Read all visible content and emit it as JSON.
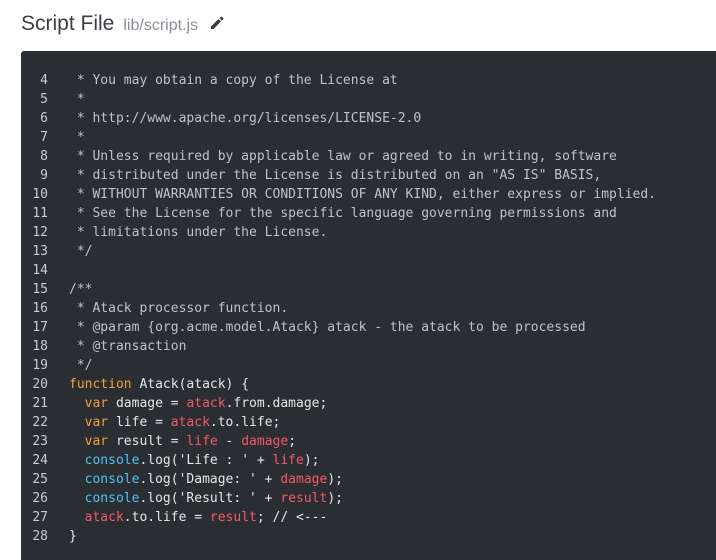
{
  "header": {
    "title": "Script File",
    "path": "lib/script.js",
    "edit_icon": "pencil-icon"
  },
  "editor": {
    "lines": [
      {
        "n": "4",
        "tokens": [
          {
            "c": "com",
            "t": " * You may obtain a copy of the License at"
          }
        ]
      },
      {
        "n": "5",
        "tokens": [
          {
            "c": "com",
            "t": " *"
          }
        ]
      },
      {
        "n": "6",
        "tokens": [
          {
            "c": "com",
            "t": " * http://www.apache.org/licenses/LICENSE-2.0"
          }
        ]
      },
      {
        "n": "7",
        "tokens": [
          {
            "c": "com",
            "t": " *"
          }
        ]
      },
      {
        "n": "8",
        "tokens": [
          {
            "c": "com",
            "t": " * Unless required by applicable law or agreed to in writing, software"
          }
        ]
      },
      {
        "n": "9",
        "tokens": [
          {
            "c": "com",
            "t": " * distributed under the License is distributed on an \"AS IS\" BASIS,"
          }
        ]
      },
      {
        "n": "10",
        "tokens": [
          {
            "c": "com",
            "t": " * WITHOUT WARRANTIES OR CONDITIONS OF ANY KIND, either express or implied."
          }
        ]
      },
      {
        "n": "11",
        "tokens": [
          {
            "c": "com",
            "t": " * See the License for the specific language governing permissions and"
          }
        ]
      },
      {
        "n": "12",
        "tokens": [
          {
            "c": "com",
            "t": " * limitations under the License."
          }
        ]
      },
      {
        "n": "13",
        "tokens": [
          {
            "c": "com",
            "t": " */"
          }
        ]
      },
      {
        "n": "14",
        "tokens": []
      },
      {
        "n": "15",
        "tokens": [
          {
            "c": "com",
            "t": "/**"
          }
        ]
      },
      {
        "n": "16",
        "tokens": [
          {
            "c": "com",
            "t": " * Atack processor function."
          }
        ]
      },
      {
        "n": "17",
        "tokens": [
          {
            "c": "com",
            "t": " * @param {org.acme.model.Atack} atack - the atack to be processed"
          }
        ]
      },
      {
        "n": "18",
        "tokens": [
          {
            "c": "com",
            "t": " * @transaction"
          }
        ]
      },
      {
        "n": "19",
        "tokens": [
          {
            "c": "com",
            "t": " */"
          }
        ]
      },
      {
        "n": "20",
        "tokens": [
          {
            "c": "kw",
            "t": "function"
          },
          {
            "c": "txt",
            "t": " Atack(atack) {"
          }
        ]
      },
      {
        "n": "21",
        "tokens": [
          {
            "c": "txt",
            "t": "  "
          },
          {
            "c": "kw",
            "t": "var"
          },
          {
            "c": "txt",
            "t": " damage = "
          },
          {
            "c": "var",
            "t": "atack"
          },
          {
            "c": "txt",
            "t": ".from.damage;"
          }
        ]
      },
      {
        "n": "22",
        "tokens": [
          {
            "c": "txt",
            "t": "  "
          },
          {
            "c": "kw",
            "t": "var"
          },
          {
            "c": "txt",
            "t": " life = "
          },
          {
            "c": "var",
            "t": "atack"
          },
          {
            "c": "txt",
            "t": ".to.life;"
          }
        ]
      },
      {
        "n": "23",
        "tokens": [
          {
            "c": "txt",
            "t": "  "
          },
          {
            "c": "kw",
            "t": "var"
          },
          {
            "c": "txt",
            "t": " result = "
          },
          {
            "c": "var",
            "t": "life"
          },
          {
            "c": "txt",
            "t": " - "
          },
          {
            "c": "var",
            "t": "damage"
          },
          {
            "c": "txt",
            "t": ";"
          }
        ]
      },
      {
        "n": "24",
        "tokens": [
          {
            "c": "txt",
            "t": "  "
          },
          {
            "c": "fn",
            "t": "console"
          },
          {
            "c": "txt",
            "t": ".log('Life : ' + "
          },
          {
            "c": "var",
            "t": "life"
          },
          {
            "c": "txt",
            "t": ");"
          }
        ]
      },
      {
        "n": "25",
        "tokens": [
          {
            "c": "txt",
            "t": "  "
          },
          {
            "c": "fn",
            "t": "console"
          },
          {
            "c": "txt",
            "t": ".log('Damage: ' + "
          },
          {
            "c": "var",
            "t": "damage"
          },
          {
            "c": "txt",
            "t": ");"
          }
        ]
      },
      {
        "n": "26",
        "tokens": [
          {
            "c": "txt",
            "t": "  "
          },
          {
            "c": "fn",
            "t": "console"
          },
          {
            "c": "txt",
            "t": ".log('Result: ' + "
          },
          {
            "c": "var",
            "t": "result"
          },
          {
            "c": "txt",
            "t": ");"
          }
        ]
      },
      {
        "n": "27",
        "tokens": [
          {
            "c": "txt",
            "t": "  "
          },
          {
            "c": "var",
            "t": "atack"
          },
          {
            "c": "txt",
            "t": ".to.life = "
          },
          {
            "c": "var",
            "t": "result"
          },
          {
            "c": "txt",
            "t": "; // <---"
          }
        ]
      },
      {
        "n": "28",
        "tokens": [
          {
            "c": "txt",
            "t": "}"
          }
        ]
      }
    ]
  },
  "colors": {
    "editor_bg": "#2a2d31",
    "comment": "#bfc3c8",
    "keyword": "#f0a23a",
    "variable": "#f25a6a",
    "builtin": "#4fc3f7",
    "text": "#e6e6e6"
  }
}
